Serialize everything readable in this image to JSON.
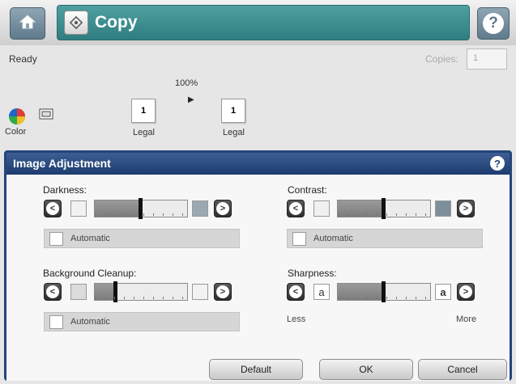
{
  "header": {
    "title": "Copy",
    "home_icon": "home-icon",
    "copy_icon": "copy-icon",
    "help_label": "?"
  },
  "status": {
    "text": "Ready",
    "copies_label": "Copies:",
    "copies_value": "1"
  },
  "preview": {
    "zoom": "100%",
    "original": {
      "count": "1",
      "size": "Legal"
    },
    "output": {
      "count": "1",
      "size": "Legal"
    },
    "color_mode": "Color"
  },
  "dialog": {
    "title": "Image Adjustment",
    "help_label": "?",
    "darkness": {
      "label": "Darkness:",
      "level": 0.5,
      "automatic_label": "Automatic"
    },
    "contrast": {
      "label": "Contrast:",
      "level": 0.5,
      "automatic_label": "Automatic"
    },
    "background_cleanup": {
      "label": "Background Cleanup:",
      "level": 0.23,
      "automatic_label": "Automatic"
    },
    "sharpness": {
      "label": "Sharpness:",
      "level": 0.5,
      "letter": "a",
      "less_label": "Less",
      "more_label": "More"
    },
    "buttons": {
      "default": "Default",
      "ok": "OK",
      "cancel": "Cancel"
    }
  },
  "colors": {
    "title_bar": "#2f7d80",
    "dialog_header": "#1d3b6e"
  }
}
